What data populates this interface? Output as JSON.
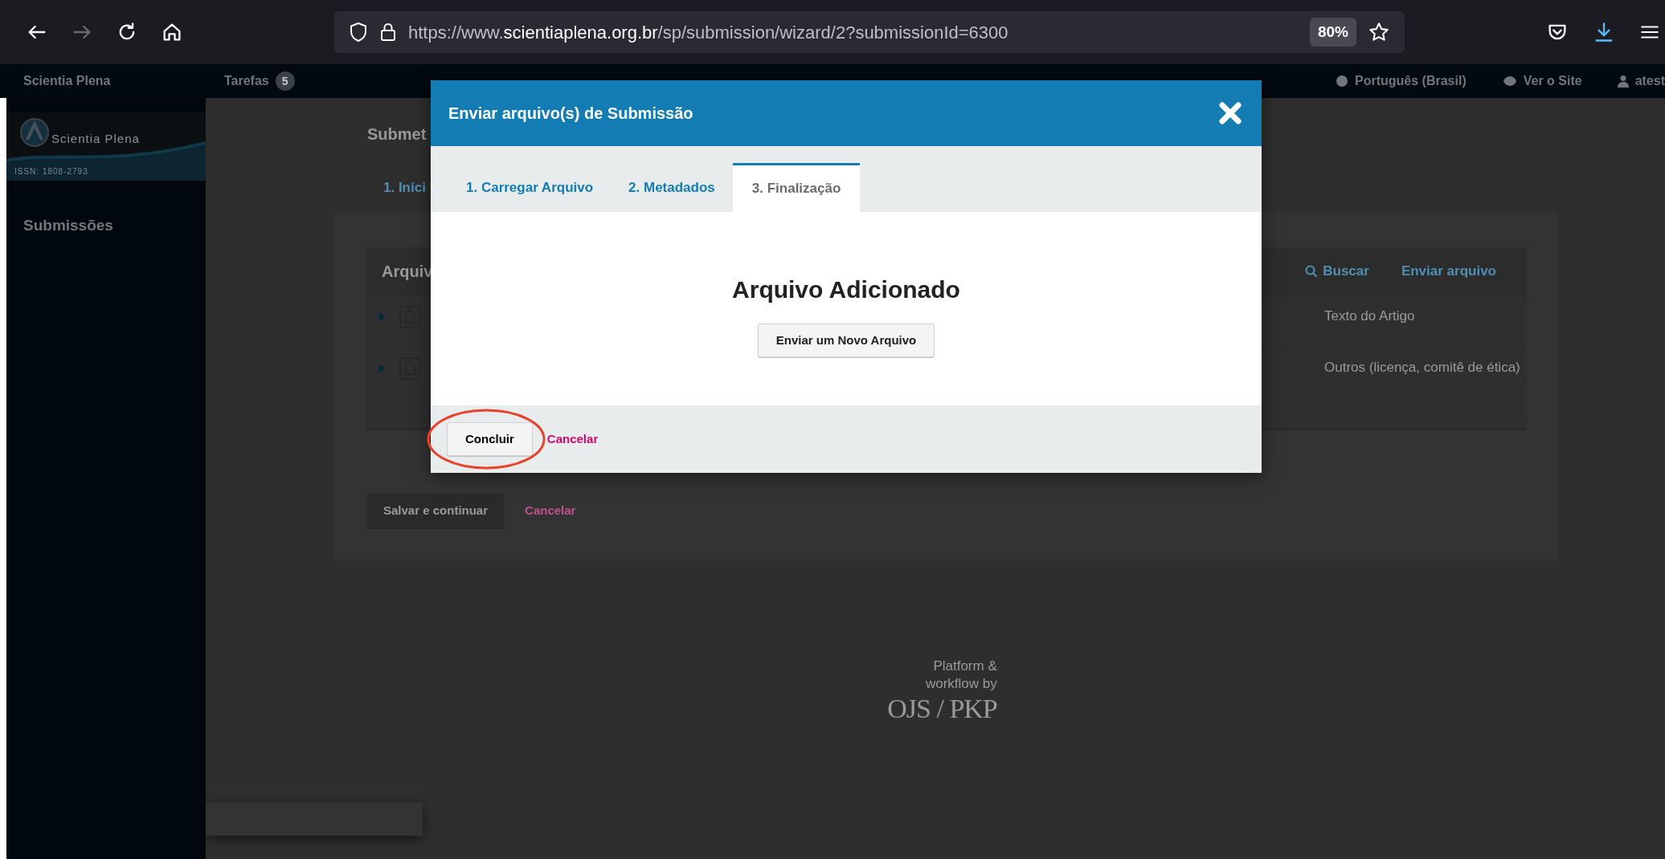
{
  "browser": {
    "nav_buttons": [
      {
        "kind": "back",
        "disabled": false
      },
      {
        "kind": "forward",
        "disabled": true
      },
      {
        "kind": "reload",
        "disabled": false
      },
      {
        "kind": "home",
        "disabled": false
      }
    ],
    "url": {
      "prefix": "https://www.",
      "domain": "scientiaplena.org.br",
      "path": "/sp/submission/wizard/2?submissionId=6300"
    },
    "zoom": "80%",
    "toolbar_icons": [
      {
        "kind": "pocket"
      },
      {
        "kind": "download"
      },
      {
        "kind": "menu"
      }
    ]
  },
  "app_header": {
    "site_name": "Scientia Plena",
    "tasks_label": "Tarefas",
    "tasks_count": "5",
    "language": "Português (Brasil)",
    "view_site": "Ver o Site",
    "user": "atest"
  },
  "sidebar": {
    "logo": {
      "title": "Scientia Plena",
      "issn": "ISSN: 1808-2793"
    },
    "items": [
      {
        "label": "Submissões"
      }
    ]
  },
  "page": {
    "title": "Submet",
    "steps": [
      {
        "label": "1. Iníci"
      }
    ],
    "files_panel": {
      "title": "Arquiv",
      "actions": [
        {
          "kind": "search",
          "label": "Buscar"
        },
        {
          "kind": "upload",
          "label": "Enviar arquivo"
        }
      ],
      "rows": [
        {
          "component": "Texto do Artigo"
        },
        {
          "component": "Outros (licença, comitê de ética)"
        }
      ]
    },
    "buttons": [
      {
        "kind": "button",
        "label": "Salvar e continuar"
      },
      {
        "kind": "link",
        "label": "Cancelar"
      }
    ]
  },
  "footer": {
    "lines": [
      "Platform &",
      "workflow by"
    ],
    "brand": "OJS / PKP"
  },
  "modal": {
    "title": "Enviar arquivo(s) de Submissão",
    "tabs": [
      {
        "label": "1. Carregar Arquivo",
        "selected": false
      },
      {
        "label": "2. Metadados",
        "selected": false
      },
      {
        "label": "3. Finalização",
        "selected": true
      }
    ],
    "heading": "Arquivo Adicionado",
    "body_button": "Enviar um Novo Arquivo",
    "footer_buttons": [
      {
        "kind": "button",
        "label": "Concluir",
        "circled": true
      },
      {
        "kind": "link",
        "label": "Cancelar",
        "circled": false
      }
    ]
  }
}
